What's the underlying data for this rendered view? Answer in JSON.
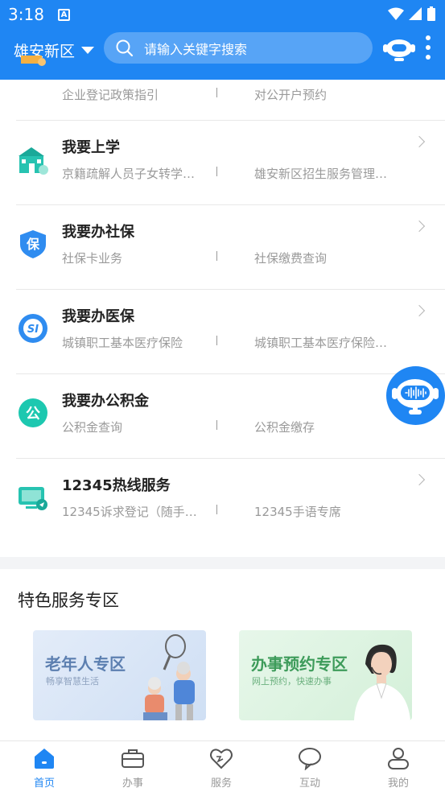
{
  "status_bar": {
    "time": "3:18",
    "notif_letter": "A"
  },
  "header": {
    "city": "雄安新区",
    "search_placeholder": "请输入关键字搜索"
  },
  "partial_row": {
    "sub1": "企业登记政策指引",
    "sub2": "对公开户预约"
  },
  "rows": [
    {
      "title": "我要上学",
      "sub1": "京籍疏解人员子女转学…",
      "sub2": "雄安新区招生服务管理…"
    },
    {
      "title": "我要办社保",
      "sub1": "社保卡业务",
      "sub2": "社保缴费查询",
      "icon_text": "保"
    },
    {
      "title": "我要办医保",
      "sub1": "城镇职工基本医疗保险",
      "sub2": "城镇职工基本医疗保险…",
      "icon_text": "SI"
    },
    {
      "title": "我要办公积金",
      "sub1": "公积金查询",
      "sub2": "公积金缴存",
      "icon_text": "公"
    },
    {
      "title": "12345热线服务",
      "sub1": "12345诉求登记（随手…",
      "sub2": "12345手语专席"
    }
  ],
  "featured": {
    "title": "特色服务专区",
    "cards": [
      {
        "title": "老年人专区",
        "subtitle": "畅享智慧生活"
      },
      {
        "title": "办事预约专区",
        "subtitle": "网上预约，快速办事"
      }
    ]
  },
  "tabbar": {
    "items": [
      {
        "label": "首页",
        "icon": "home-icon",
        "active": true
      },
      {
        "label": "办事",
        "icon": "briefcase-icon",
        "active": false
      },
      {
        "label": "服务",
        "icon": "heart-icon",
        "active": false
      },
      {
        "label": "互动",
        "icon": "chat-bubble-icon",
        "active": false
      },
      {
        "label": "我的",
        "icon": "user-icon",
        "active": false
      }
    ]
  },
  "colors": {
    "primary": "#1f86f3",
    "teal": "#1dc8b0",
    "muted": "#9a9a9a"
  }
}
